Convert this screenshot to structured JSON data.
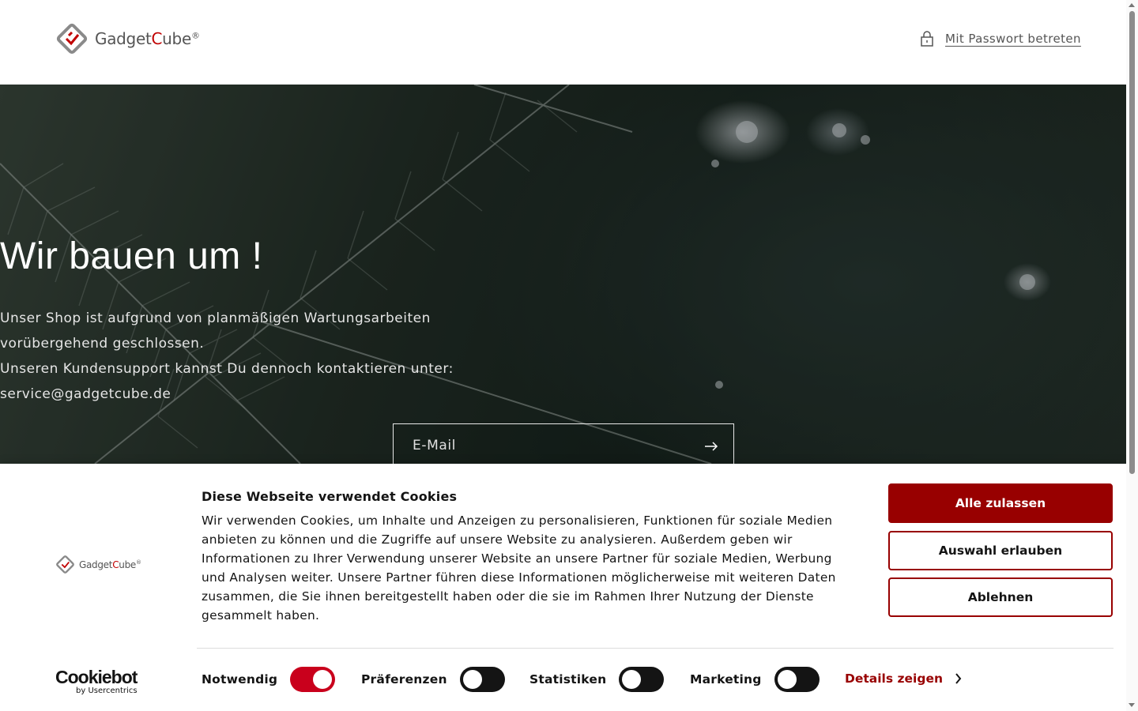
{
  "header": {
    "logo_text_a": "Gadget",
    "logo_text_b": "C",
    "logo_text_c": "ube",
    "logo_reg": "®",
    "password_link": "Mit Passwort betreten"
  },
  "hero": {
    "title": "Wir bauen um !",
    "line1": "Unser Shop ist aufgrund von planmäßigen Wartungsarbeiten",
    "line2": "vorübergehend geschlossen.",
    "line3": "Unseren Kundensupport kannst Du dennoch kontaktieren unter:",
    "line4": "service@gadgetcube.de",
    "email_placeholder": "E-Mail"
  },
  "cookie_banner": {
    "title": "Diese Webseite verwendet Cookies",
    "body": "Wir verwenden Cookies, um Inhalte und Anzeigen zu personalisieren, Funktionen für soziale Medien anbieten zu können und die Zugriffe auf unsere Website zu analysieren. Außerdem geben wir Informationen zu Ihrer Verwendung unserer Website an unsere Partner für soziale Medien, Werbung und Analysen weiter. Unsere Partner führen diese Informationen möglicherweise mit weiteren Daten zusammen, die Sie ihnen bereitgestellt haben oder die sie im Rahmen Ihrer Nutzung der Dienste gesammelt haben.",
    "btn_allow_all": "Alle zulassen",
    "btn_allow_selection": "Auswahl erlauben",
    "btn_decline": "Ablehnen",
    "cookiebot_name": "Cookiebot",
    "cookiebot_by": "by Usercentrics",
    "toggles": [
      {
        "label": "Notwendig",
        "state": "on"
      },
      {
        "label": "Präferenzen",
        "state": "off"
      },
      {
        "label": "Statistiken",
        "state": "off"
      },
      {
        "label": "Marketing",
        "state": "off"
      }
    ],
    "details_link": "Details zeigen"
  },
  "colors": {
    "accent": "#980000",
    "toggle_on": "#c9001c",
    "toggle_off": "#141414"
  }
}
